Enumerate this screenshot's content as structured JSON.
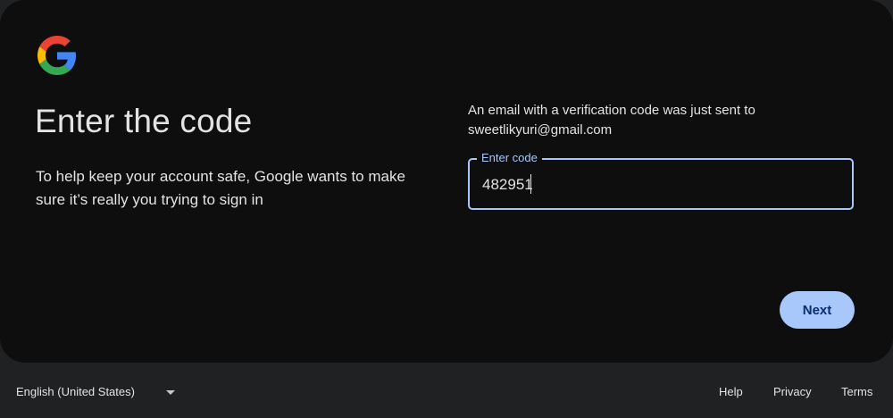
{
  "logo": {
    "icon": "google-g-logo-icon"
  },
  "main": {
    "title": "Enter the code",
    "subtitle": "To help keep your account safe, Google wants to make sure it’s really you trying to sign in",
    "info_line1": "An email with a verification code was just sent to",
    "info_line2": "sweetlikyuri@gmail.com",
    "code_field": {
      "label": "Enter code",
      "value": "482951"
    },
    "next_label": "Next"
  },
  "footer": {
    "language": "English (United States)",
    "help": "Help",
    "privacy": "Privacy",
    "terms": "Terms"
  },
  "colors": {
    "accent": "#a8c7fa",
    "card_bg": "#0e0e0f",
    "page_bg": "#1f2123",
    "button_text": "#062e6f"
  }
}
